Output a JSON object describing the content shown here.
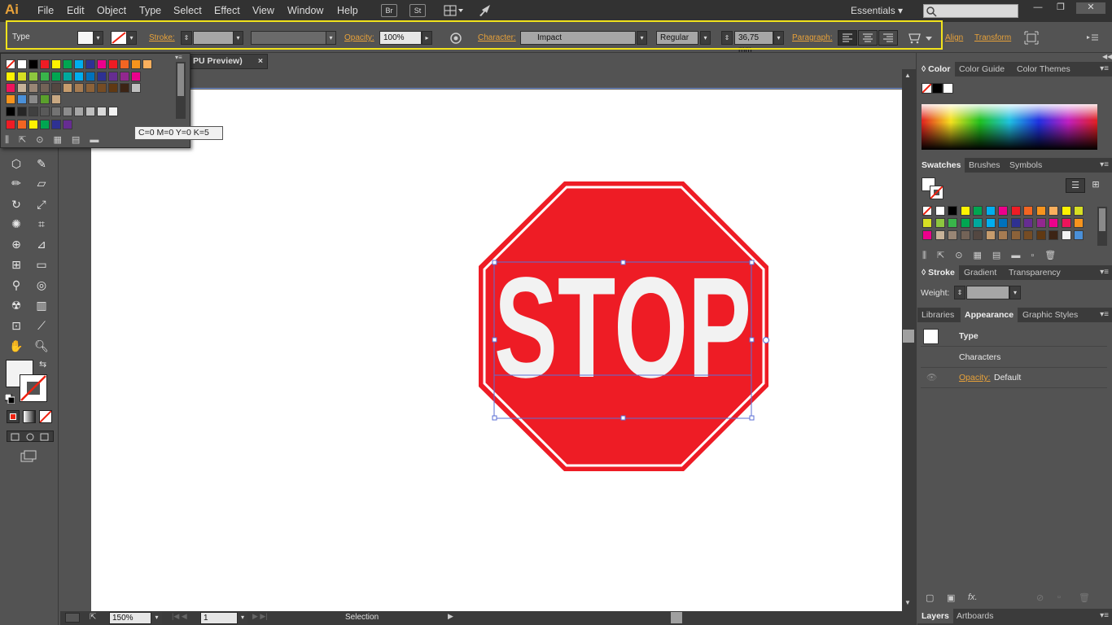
{
  "app": {
    "logo": "Ai"
  },
  "menu": [
    "File",
    "Edit",
    "Object",
    "Type",
    "Select",
    "Effect",
    "View",
    "Window",
    "Help"
  ],
  "menu_buttons": {
    "bridge": "Br",
    "stock": "St"
  },
  "workspace": {
    "label": "Essentials",
    "arrow": "▾"
  },
  "window_controls": {
    "minimize": "—",
    "restore": "❐",
    "close": "✕"
  },
  "control_bar": {
    "object_type": "Type",
    "stroke_label": "Stroke:",
    "opacity_label": "Opacity:",
    "opacity_value": "100%",
    "character_label": "Character:",
    "font_name": "Impact",
    "font_style": "Regular",
    "font_size": "36,75 mm",
    "paragraph_label": "Paragraph:",
    "align_label": "Align",
    "transform_label": "Transform"
  },
  "document": {
    "tab_title": "PU Preview)",
    "tab_close": "×",
    "sign_text": "STOP",
    "sign_colors": {
      "fill": "#ee1c25",
      "text": "#f2f2f2"
    }
  },
  "swatch_popup": {
    "tooltip": "C=0 M=0 Y=0 K=5",
    "rows": [
      [
        "#ffffff",
        "#ffffff",
        "#000000",
        "#ee1c25",
        "#fff200",
        "#00a651",
        "#00aeef",
        "#2e3192",
        "#ec008c",
        "#ed1c24",
        "#f26522",
        "#f7941d",
        "#fbaf5d"
      ],
      [
        "#fff200",
        "#d7df23",
        "#8dc63f",
        "#39b54a",
        "#00a651",
        "#00a99d",
        "#00aeef",
        "#0072bc",
        "#2e3192",
        "#662d91",
        "#92278f",
        "#ec008c"
      ],
      [
        "#ed145b",
        "#c7b299",
        "#998675",
        "#736357",
        "#534741",
        "#c69c6d",
        "#a67c52",
        "#8c6239",
        "#754c24",
        "#603913",
        "#3c2415",
        "#c0c0c0"
      ],
      [
        "#f7941d",
        "#4a90d9",
        "#8a8a8a",
        "#5aa02c",
        "#c8a882"
      ],
      [
        "#000000",
        "#262626",
        "#404040",
        "#595959",
        "#737373",
        "#8c8c8c",
        "#a6a6a6",
        "#bfbfbf",
        "#d9d9d9",
        "#f2f2f2"
      ],
      [
        "#ee1c25",
        "#f26522",
        "#fff200",
        "#00a651",
        "#2e3192",
        "#662d91"
      ]
    ]
  },
  "panels": {
    "color_tabs": [
      "Color",
      "Color Guide",
      "Color Themes"
    ],
    "swatches_tabs": [
      "Swatches",
      "Brushes",
      "Symbols"
    ],
    "stroke_tabs": [
      "Stroke",
      "Gradient",
      "Transparency"
    ],
    "stroke_weight_label": "Weight:",
    "appearance_tabs": [
      "Libraries",
      "Appearance",
      "Graphic Styles"
    ],
    "appearance_rows": {
      "type": "Type",
      "characters": "Characters",
      "opacity_label": "Opacity:",
      "opacity_value": "Default"
    },
    "bottom_tabs": [
      "Layers",
      "Artboards"
    ],
    "swatches": [
      [
        "#ffffff",
        "#ffffff",
        "#000000",
        "#fff200",
        "#00a651",
        "#00aeef",
        "#ec008c",
        "#ee1c25",
        "#f26522",
        "#f7941d",
        "#fbaf5d",
        "#fff200",
        "#d7df23"
      ],
      [
        "#d7df23",
        "#8dc63f",
        "#39b54a",
        "#00a651",
        "#00a99d",
        "#00aeef",
        "#0072bc",
        "#2e3192",
        "#662d91",
        "#92278f",
        "#ec008c",
        "#ed145b",
        "#f7941d"
      ],
      [
        "#ec008c",
        "#c7b299",
        "#998675",
        "#736357",
        "#534741",
        "#c69c6d",
        "#a67c52",
        "#8c6239",
        "#754c24",
        "#603913",
        "#3c2415",
        "#f2f2f2",
        "#4a90d9"
      ]
    ]
  },
  "status": {
    "zoom": "150%",
    "page": "1",
    "tool": "Selection"
  }
}
